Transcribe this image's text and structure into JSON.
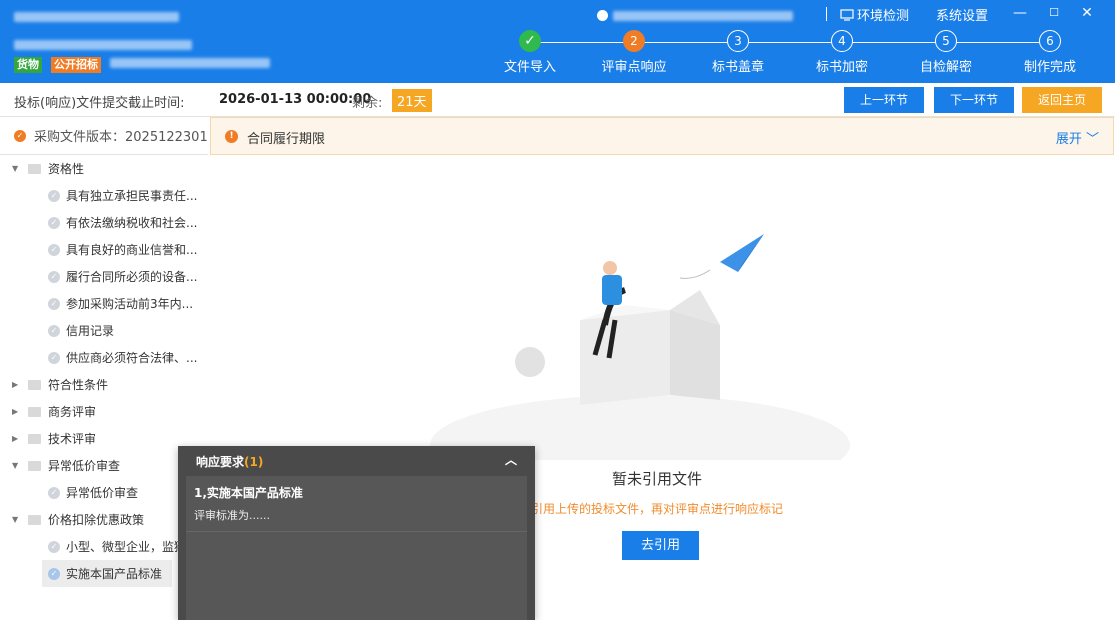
{
  "header": {
    "tags": {
      "goods": "货物",
      "public": "公开招标"
    },
    "env_check": "环境检测",
    "settings": "系统设置",
    "window": {
      "minimize": "—",
      "maximize": "☐",
      "close": "✕"
    }
  },
  "steps": [
    {
      "num": "✓",
      "label": "文件导入",
      "state": "done"
    },
    {
      "num": "2",
      "label": "评审点响应",
      "state": "active"
    },
    {
      "num": "3",
      "label": "标书盖章",
      "state": "todo"
    },
    {
      "num": "4",
      "label": "标书加密",
      "state": "todo"
    },
    {
      "num": "5",
      "label": "自检解密",
      "state": "todo"
    },
    {
      "num": "6",
      "label": "制作完成",
      "state": "todo"
    }
  ],
  "deadline": {
    "label": "投标(响应)文件提交截止时间:",
    "date": "2026-01-13 00:00:00",
    "remain_label": "剩余:",
    "days": "21天"
  },
  "actions": {
    "prev": "上一环节",
    "next": "下一环节",
    "home": "返回主页"
  },
  "sidebar": {
    "version_label": "采购文件版本：2025122301",
    "tree": [
      {
        "type": "group",
        "label": "资格性",
        "expanded": true
      },
      {
        "type": "leaf",
        "label": "具有独立承担民事责任..."
      },
      {
        "type": "leaf",
        "label": "有依法缴纳税收和社会..."
      },
      {
        "type": "leaf",
        "label": "具有良好的商业信誉和..."
      },
      {
        "type": "leaf",
        "label": "履行合同所必须的设备..."
      },
      {
        "type": "leaf",
        "label": "参加采购活动前3年内..."
      },
      {
        "type": "leaf",
        "label": "信用记录"
      },
      {
        "type": "leaf",
        "label": "供应商必须符合法律、..."
      },
      {
        "type": "group",
        "label": "符合性条件",
        "expanded": false
      },
      {
        "type": "group",
        "label": "商务评审",
        "expanded": false
      },
      {
        "type": "group",
        "label": "技术评审",
        "expanded": false
      },
      {
        "type": "group",
        "label": "异常低价审查",
        "expanded": true
      },
      {
        "type": "leaf",
        "label": "异常低价审查"
      },
      {
        "type": "group",
        "label": "价格扣除优惠政策",
        "expanded": true
      },
      {
        "type": "leaf",
        "label": "小型、微型企业，监狱"
      },
      {
        "type": "leaf",
        "label": "实施本国产品标准",
        "selected": true
      }
    ]
  },
  "notice": {
    "text": "合同履行期限",
    "expand": "展开"
  },
  "empty": {
    "title": "暂未引用文件",
    "hint": "引用上传的投标文件，再对评审点进行响应标记",
    "button": "去引用"
  },
  "popup": {
    "title": "响应要求",
    "count": "(1)",
    "items": [
      {
        "title": "1,实施本国产品标准",
        "desc": "评审标准为......"
      }
    ]
  },
  "colors": {
    "primary": "#1a7ee8",
    "orange": "#f5a623",
    "green": "#30b94d"
  }
}
